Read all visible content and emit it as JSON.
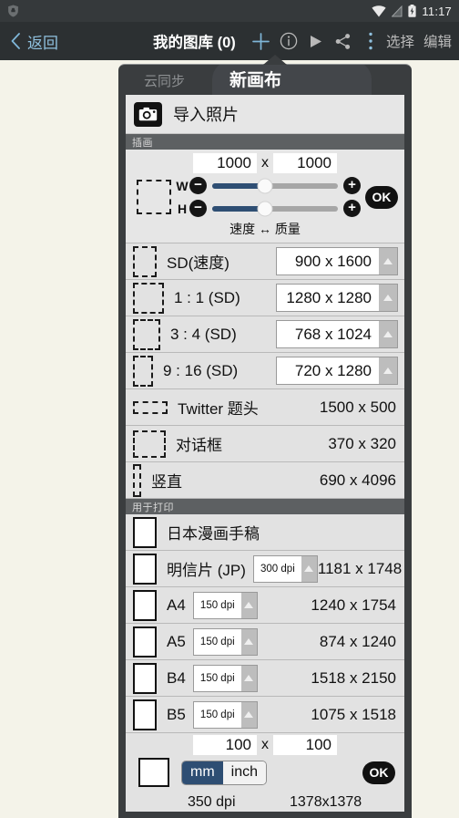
{
  "statusbar": {
    "shield_icon": "shield-icon",
    "wifi_icon": "wifi-icon",
    "signal_icon": "signal-off-icon",
    "battery_icon": "battery-charging-icon",
    "time": "11:17"
  },
  "appbar": {
    "back_label": "返回",
    "title": "我的图库 (0)",
    "icons": [
      "add-icon",
      "info-icon",
      "play-icon",
      "share-icon",
      "overflow-icon"
    ],
    "select_label": "选择",
    "edit_label": "编辑",
    "accent": "#8fc0de"
  },
  "dialog": {
    "tab_inactive": "云同步",
    "tab_active": "新画布",
    "import": {
      "label": "导入照片",
      "icon": "camera-icon"
    },
    "section_illustration": "插画",
    "section_print": "用于打印",
    "canvas_size": {
      "width_value": "1000",
      "x_sep": "x",
      "height_value": "1000",
      "w_label": "W",
      "h_label": "H",
      "minus": "−",
      "plus": "+",
      "ok_label": "OK",
      "footer": "速度 ↔ 质量",
      "w_percent": 42,
      "h_percent": 42
    },
    "illustration_presets": [
      {
        "name": "SD(速度)",
        "size": "900 x 1600",
        "thumb_w": 26,
        "thumb_h": 34,
        "spinner": true
      },
      {
        "name": "1 : 1 (SD)",
        "size": "1280 x 1280",
        "thumb_w": 34,
        "thumb_h": 34,
        "spinner": true
      },
      {
        "name": "3 : 4 (SD)",
        "size": "768 x 1024",
        "thumb_w": 30,
        "thumb_h": 34,
        "spinner": true
      },
      {
        "name": "9 : 16 (SD)",
        "size": "720 x 1280",
        "thumb_w": 22,
        "thumb_h": 34,
        "spinner": true
      },
      {
        "name": "Twitter 题头",
        "size": "1500 x 500",
        "thumb_w": 38,
        "thumb_h": 14,
        "spinner": false
      },
      {
        "name": "对话框",
        "size": "370 x 320",
        "thumb_w": 36,
        "thumb_h": 30,
        "spinner": false
      },
      {
        "name": "竖直",
        "size": "690 x 4096",
        "thumb_w": 9,
        "thumb_h": 36,
        "spinner": false
      }
    ],
    "print_presets": [
      {
        "name": "日本漫画手稿",
        "dpi": "",
        "size": "",
        "thumb_w": 26,
        "thumb_h": 34
      },
      {
        "name": "明信片 (JP)",
        "dpi": "300 dpi",
        "size": "1181 x 1748",
        "thumb_w": 26,
        "thumb_h": 34
      },
      {
        "name": "A4",
        "dpi": "150 dpi",
        "size": "1240 x 1754",
        "thumb_w": 26,
        "thumb_h": 34
      },
      {
        "name": "A5",
        "dpi": "150 dpi",
        "size": "874 x 1240",
        "thumb_w": 26,
        "thumb_h": 34
      },
      {
        "name": "B4",
        "dpi": "150 dpi",
        "size": "1518 x 2150",
        "thumb_w": 26,
        "thumb_h": 34
      },
      {
        "name": "B5",
        "dpi": "150 dpi",
        "size": "1075 x 1518",
        "thumb_w": 26,
        "thumb_h": 34
      }
    ],
    "custom": {
      "width_value": "100",
      "x_sep": "x",
      "height_value": "100",
      "unit_mm": "mm",
      "unit_inch": "inch",
      "ok_label": "OK",
      "dpi_text": "350 dpi",
      "result_text": "1378x1378"
    }
  }
}
